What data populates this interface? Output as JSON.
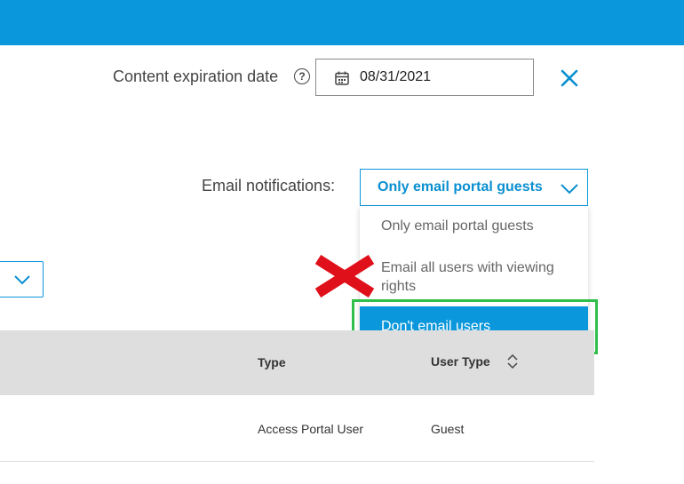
{
  "colors": {
    "primary": "#0a97db",
    "selection_outline": "#2fbf4a",
    "annotation_x": "#e0101a"
  },
  "expiration": {
    "label": "Content expiration date",
    "help_icon": "?",
    "date_value": "08/31/2021"
  },
  "email_notifications": {
    "label": "Email notifications:",
    "selected": "Only email portal guests",
    "options": [
      "Only email portal guests",
      "Email all users with viewing rights",
      "Don't email users"
    ]
  },
  "table": {
    "columns": [
      "Type",
      "User Type"
    ],
    "rows": [
      {
        "type": "Access Portal User",
        "user_type": "Guest"
      }
    ]
  },
  "icons": {
    "close": "close-icon",
    "calendar": "calendar-icon",
    "help": "help-icon",
    "chevron": "chevron-down-icon",
    "sort": "sort-icon"
  }
}
